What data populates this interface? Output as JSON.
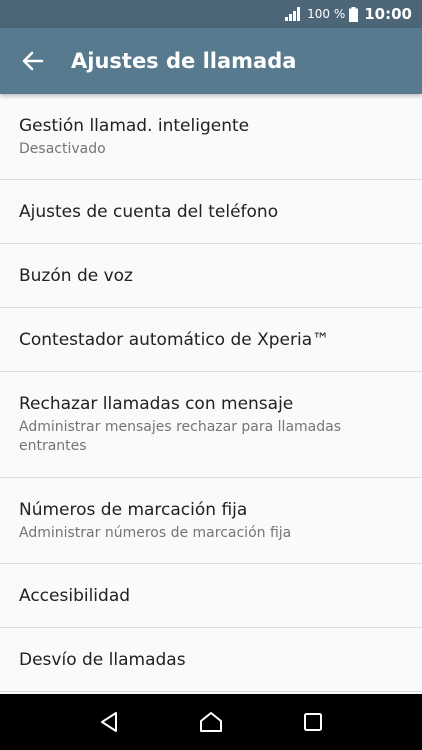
{
  "status": {
    "battery_pct": "100 %",
    "time": "10:00"
  },
  "app_bar": {
    "title": "Ajustes de llamada"
  },
  "items": [
    {
      "title": "Gestión llamad. inteligente",
      "subtitle": "Desactivado"
    },
    {
      "title": "Ajustes de cuenta del teléfono",
      "subtitle": ""
    },
    {
      "title": "Buzón de voz",
      "subtitle": ""
    },
    {
      "title": "Contestador automático de Xperia™",
      "subtitle": ""
    },
    {
      "title": "Rechazar llamadas con mensaje",
      "subtitle": "Administrar mensajes rechazar para llamadas entrantes"
    },
    {
      "title": "Números de marcación fija",
      "subtitle": "Administrar números de marcación fija"
    },
    {
      "title": "Accesibilidad",
      "subtitle": ""
    },
    {
      "title": "Desvío de llamadas",
      "subtitle": ""
    }
  ]
}
